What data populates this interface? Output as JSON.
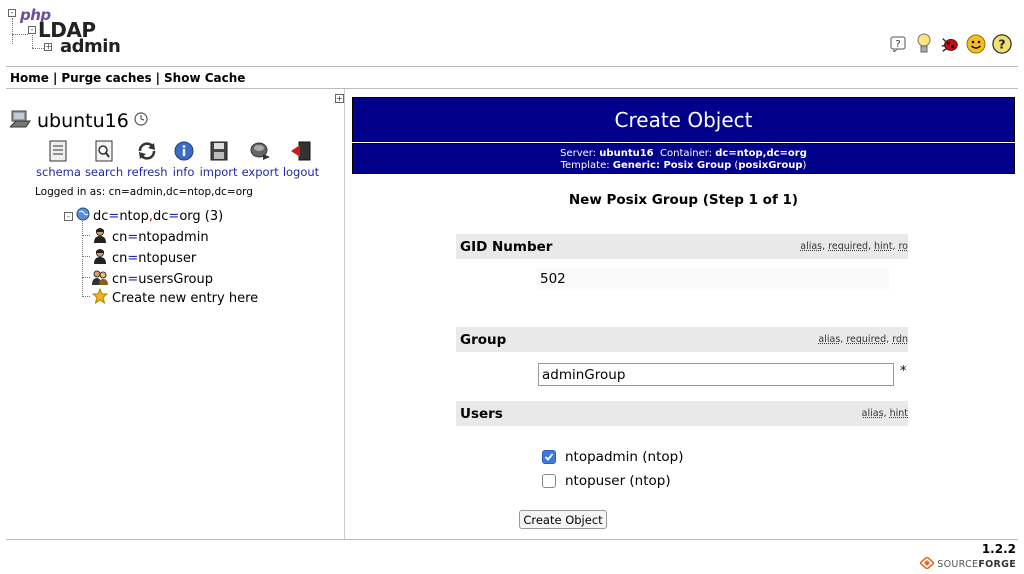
{
  "app": {
    "logo": {
      "php": "php",
      "ldap": "LDAP",
      "admin": "admin"
    },
    "version": "1.2.2",
    "footer_brand_a": "SOURCE",
    "footer_brand_b": "FORGE"
  },
  "top_icons": [
    "help-icon",
    "bulb-icon",
    "bug-icon",
    "smiley-icon",
    "question-icon"
  ],
  "nav": {
    "home": "Home",
    "purge": "Purge caches",
    "show_cache": "Show Cache",
    "sep": "|"
  },
  "server": {
    "name": "ubuntu16",
    "logged_in": "Logged in as: cn=admin,dc=ntop,dc=org"
  },
  "tools": [
    {
      "label": "schema",
      "icon": "schema-icon"
    },
    {
      "label": "search",
      "icon": "search-icon"
    },
    {
      "label": "refresh",
      "icon": "refresh-icon"
    },
    {
      "label": "info",
      "icon": "info-icon"
    },
    {
      "label": "import",
      "icon": "import-icon"
    },
    {
      "label": "export",
      "icon": "export-icon"
    },
    {
      "label": "logout",
      "icon": "logout-icon"
    }
  ],
  "tree": {
    "root_a": "dc",
    "root_b": "ntop",
    "root_c": "dc",
    "root_d": "org",
    "root_count": "(3)",
    "items": [
      {
        "attr": "cn",
        "value": "ntopadmin"
      },
      {
        "attr": "cn",
        "value": "ntopuser"
      },
      {
        "attr": "cn",
        "value": "usersGroup"
      }
    ],
    "create_new": "Create new entry here"
  },
  "form": {
    "title": "Create Object",
    "server_label": "Server:",
    "server_value": "ubuntu16",
    "container_label": "Container:",
    "container_value": "dc=ntop,dc=org",
    "template_label": "Template:",
    "template_value": "Generic: Posix Group",
    "template_class": "posixGroup",
    "subtitle": "New Posix Group (Step 1 of 1)",
    "gid": {
      "label": "GID Number",
      "hints": [
        "alias",
        "required",
        "hint",
        "ro"
      ],
      "value": "502"
    },
    "group": {
      "label": "Group",
      "hints": [
        "alias",
        "required",
        "rdn"
      ],
      "value": "adminGroup",
      "required_mark": "*"
    },
    "users": {
      "label": "Users",
      "hints": [
        "alias",
        "hint"
      ],
      "options": [
        {
          "label": "ntopadmin (ntop)",
          "checked": true
        },
        {
          "label": "ntopuser (ntop)",
          "checked": false
        }
      ]
    },
    "submit": "Create Object"
  }
}
